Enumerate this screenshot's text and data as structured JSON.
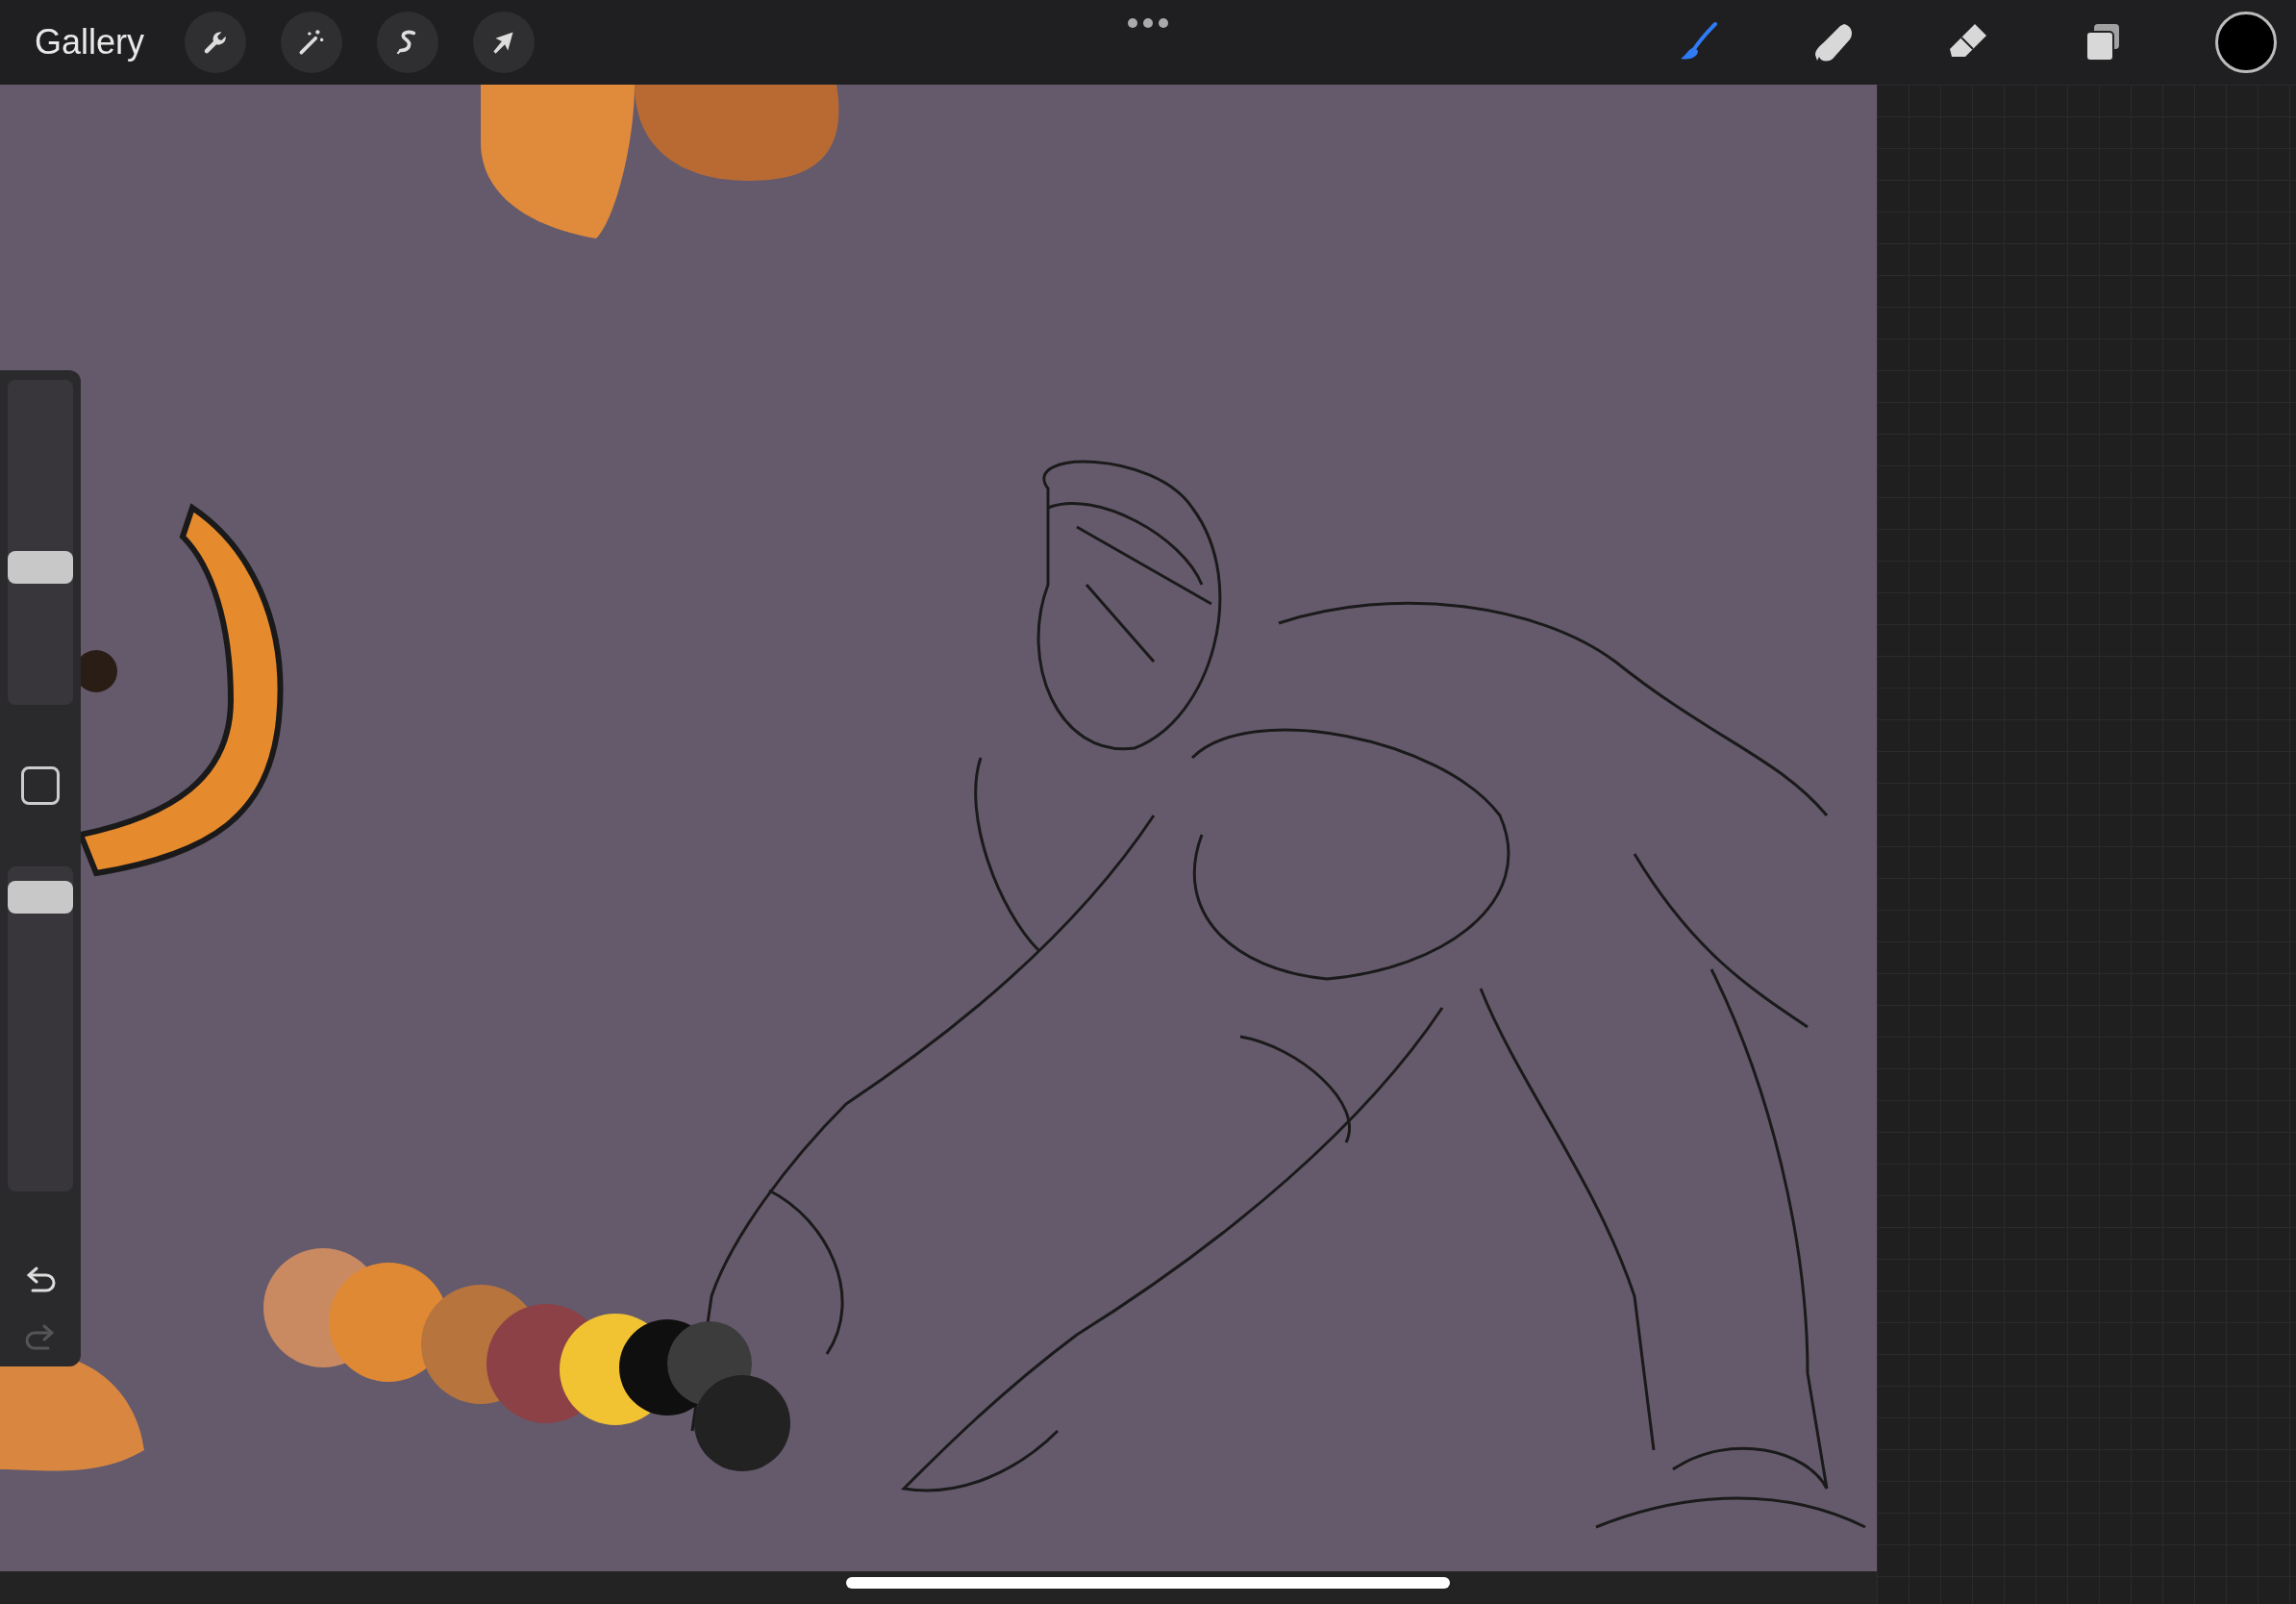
{
  "toolbar": {
    "gallery": "Gallery",
    "left_tools": [
      {
        "kind": "wrench"
      },
      {
        "kind": "wand"
      },
      {
        "kind": "selection"
      },
      {
        "kind": "transform"
      }
    ],
    "right_tools": [
      {
        "kind": "brush",
        "selected": true
      },
      {
        "kind": "smudge",
        "selected": false
      },
      {
        "kind": "eraser",
        "selected": false
      },
      {
        "kind": "layers",
        "selected": false
      }
    ]
  },
  "sidebar": {
    "brush_size": {
      "level": 0.41
    },
    "opacity": {
      "level": 0.95
    },
    "undo": {
      "disabled": false
    },
    "redo": {
      "disabled": true
    }
  }
}
